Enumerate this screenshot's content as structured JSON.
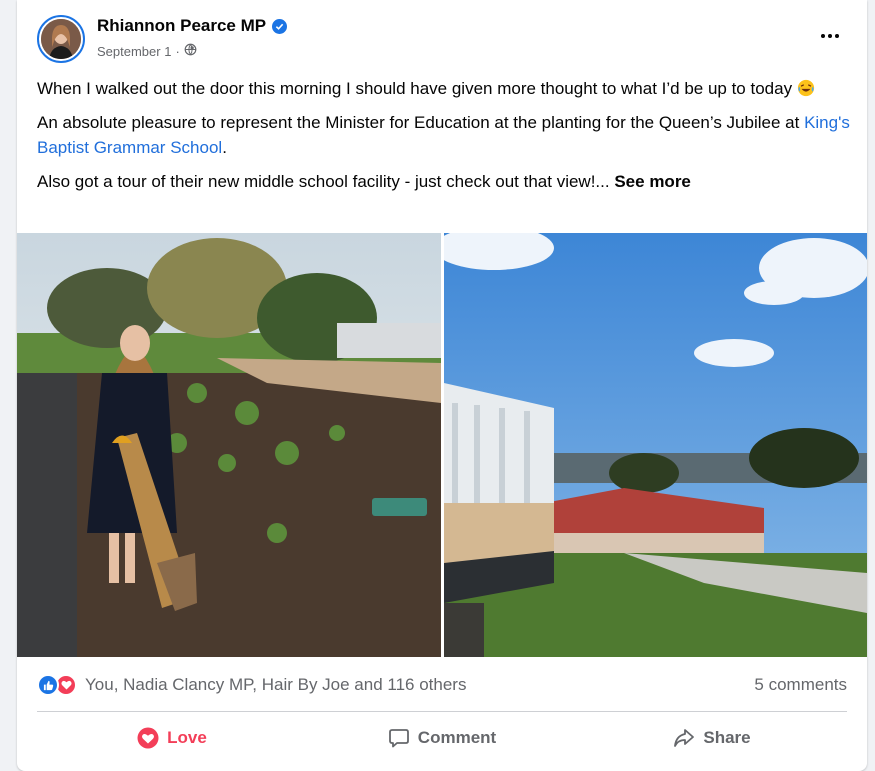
{
  "post": {
    "author": "Rhiannon Pearce MP",
    "date": "September 1",
    "separator": "·",
    "paragraph1": "When I walked out the door this morning I should have given more thought to what I’d be up to today",
    "paragraph2_before": "An absolute pleasure to represent the Minister for Education at the planting for the Queen’s Jubilee at ",
    "paragraph2_link": "King's Baptist Grammar School",
    "paragraph2_after": ".",
    "paragraph3": "Also got a tour of their new middle school facility - just check out that view!...",
    "see_more": "See more"
  },
  "stats": {
    "reactions_text": "You, Nadia Clancy MP, Hair By Joe and 116 others",
    "comments": "5 comments"
  },
  "actions": {
    "love": "Love",
    "comment": "Comment",
    "share": "Share"
  },
  "colors": {
    "accent": "#1b74e4",
    "love": "#f33e58",
    "link": "#216fdb"
  },
  "icons": {
    "verified": "verified-badge-icon",
    "privacy": "globe-icon",
    "more": "more-options-icon"
  }
}
